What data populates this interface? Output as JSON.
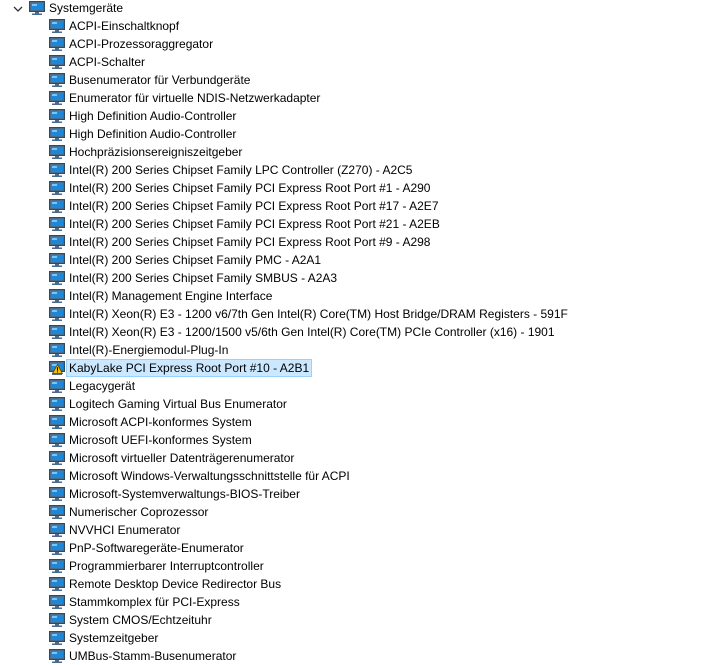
{
  "category": {
    "label": "Systemgeräte",
    "expanded": true
  },
  "colors": {
    "selection_bg": "#cce8ff",
    "selection_border": "#99d1ff",
    "monitor_frame": "#4a6b8a",
    "monitor_screen": "#1e88d8",
    "warning_yellow": "#f2c200"
  },
  "icons": {
    "expander": "chevron-down-icon",
    "category": "system-devices-icon",
    "device": "system-device-icon",
    "warning": "warning-icon"
  },
  "devices": [
    {
      "label": "ACPI-Einschaltknopf"
    },
    {
      "label": "ACPI-Prozessoraggregator"
    },
    {
      "label": "ACPI-Schalter"
    },
    {
      "label": "Busenumerator für Verbundgeräte"
    },
    {
      "label": "Enumerator für virtuelle NDIS-Netzwerkadapter"
    },
    {
      "label": "High Definition Audio-Controller"
    },
    {
      "label": "High Definition Audio-Controller"
    },
    {
      "label": "Hochpräzisionsereigniszeitgeber"
    },
    {
      "label": "Intel(R) 200 Series Chipset Family LPC Controller (Z270) - A2C5"
    },
    {
      "label": "Intel(R) 200 Series Chipset Family PCI Express Root Port #1 - A290"
    },
    {
      "label": "Intel(R) 200 Series Chipset Family PCI Express Root Port #17 - A2E7"
    },
    {
      "label": "Intel(R) 200 Series Chipset Family PCI Express Root Port #21 - A2EB"
    },
    {
      "label": "Intel(R) 200 Series Chipset Family PCI Express Root Port #9 - A298"
    },
    {
      "label": "Intel(R) 200 Series Chipset Family PMC - A2A1"
    },
    {
      "label": "Intel(R) 200 Series Chipset Family SMBUS - A2A3"
    },
    {
      "label": "Intel(R) Management Engine Interface"
    },
    {
      "label": "Intel(R) Xeon(R) E3 - 1200 v6/7th Gen Intel(R) Core(TM) Host Bridge/DRAM Registers - 591F"
    },
    {
      "label": "Intel(R) Xeon(R) E3 - 1200/1500 v5/6th Gen Intel(R) Core(TM) PCIe Controller (x16) - 1901"
    },
    {
      "label": "Intel(R)-Energiemodul-Plug-In"
    },
    {
      "label": "KabyLake PCI Express Root Port #10 - A2B1",
      "warning": true,
      "selected": true
    },
    {
      "label": "Legacygerät"
    },
    {
      "label": "Logitech Gaming Virtual Bus Enumerator"
    },
    {
      "label": "Microsoft ACPI-konformes System"
    },
    {
      "label": "Microsoft UEFI-konformes System"
    },
    {
      "label": "Microsoft virtueller Datenträgerenumerator"
    },
    {
      "label": "Microsoft Windows-Verwaltungsschnittstelle für ACPI"
    },
    {
      "label": "Microsoft-Systemverwaltungs-BIOS-Treiber"
    },
    {
      "label": "Numerischer Coprozessor"
    },
    {
      "label": "NVVHCI Enumerator"
    },
    {
      "label": "PnP-Softwaregeräte-Enumerator"
    },
    {
      "label": "Programmierbarer Interruptcontroller"
    },
    {
      "label": "Remote Desktop Device Redirector Bus"
    },
    {
      "label": "Stammkomplex für PCI-Express"
    },
    {
      "label": "System CMOS/Echtzeituhr"
    },
    {
      "label": "Systemzeitgeber"
    },
    {
      "label": "UMBus-Stamm-Busenumerator"
    }
  ]
}
